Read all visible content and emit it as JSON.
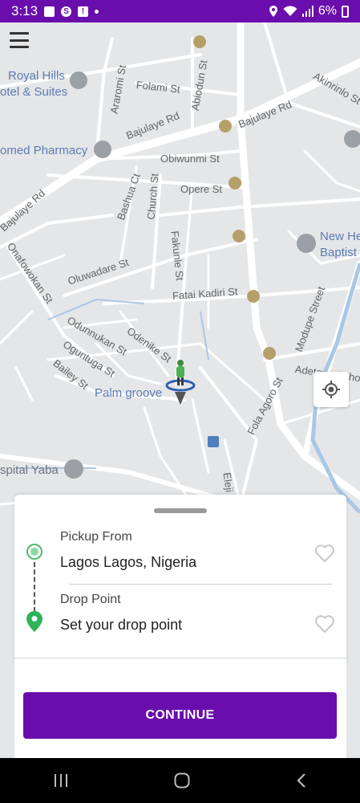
{
  "status_bar": {
    "time": "3:13",
    "battery": "6%",
    "notif_icons": [
      "image-icon",
      "skype-icon",
      "alert-icon"
    ]
  },
  "map": {
    "street_labels": [
      {
        "text": "Araromi St"
      },
      {
        "text": "Abiodun St"
      },
      {
        "text": "Folami St"
      },
      {
        "text": "Bajulaye Rd"
      },
      {
        "text": "Bajulaye Rd"
      },
      {
        "text": "Akinrinlo St"
      },
      {
        "text": "Obiwunmi St"
      },
      {
        "text": "Opere St"
      },
      {
        "text": "Bashua Ct"
      },
      {
        "text": "Church St"
      },
      {
        "text": "Bajulaye Rd"
      },
      {
        "text": "Onafowokan St"
      },
      {
        "text": "Oluwadare St"
      },
      {
        "text": "Fakunle St"
      },
      {
        "text": "Fatai Kadiri St"
      },
      {
        "text": "Modupe Street"
      },
      {
        "text": "Odunnukan St"
      },
      {
        "text": "Oguntuga St"
      },
      {
        "text": "Odenike St"
      },
      {
        "text": "Bailey St"
      },
      {
        "text": "Adetayo Osho"
      },
      {
        "text": "Fola Agoro St"
      },
      {
        "text": "Eleji St"
      }
    ],
    "poi_labels": [
      {
        "text": "Royal Hills"
      },
      {
        "text": "otel & Suites"
      },
      {
        "text": "omed Pharmacy"
      },
      {
        "text": "New He"
      },
      {
        "text": "Baptist"
      },
      {
        "text": "Palm groove"
      },
      {
        "text": "spital Yaba"
      }
    ]
  },
  "panel": {
    "pickup_label": "Pickup From",
    "pickup_value": "Lagos Lagos, Nigeria",
    "drop_label": "Drop Point",
    "drop_value": "Set your drop point"
  },
  "continue_label": "CONTINUE",
  "colors": {
    "brand": "#6a0dad",
    "pickup_green": "#4dbb6c",
    "drop_green": "#2db35a"
  }
}
